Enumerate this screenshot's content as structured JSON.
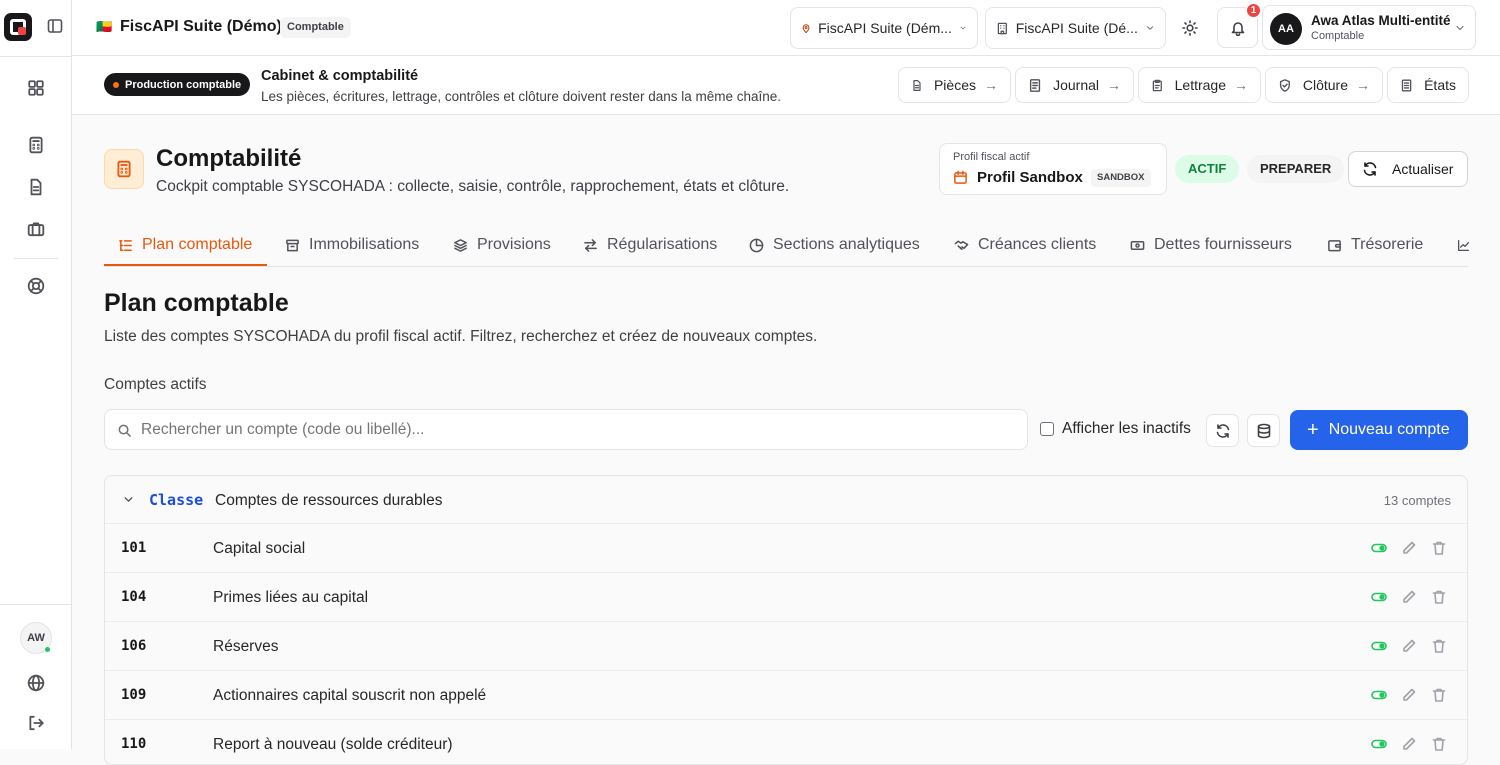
{
  "app": {
    "name": "FiscAPI Suite (Démo)",
    "role_badge": "Comptable",
    "flag": "🇧🇯"
  },
  "topbar": {
    "org_select": "FiscAPI Suite (Dém...",
    "entity_select": "FiscAPI Suite (Dé...",
    "notifications_count": "1",
    "user": {
      "initials": "AA",
      "name": "Awa Atlas Multi-entité",
      "role": "Comptable"
    }
  },
  "sidebar": {
    "items": [
      "dashboard",
      "calculator",
      "documents",
      "briefcase",
      "support"
    ],
    "user_initials": "AW"
  },
  "banner": {
    "badge": "Production comptable",
    "title": "Cabinet & comptabilité",
    "subtitle": "Les pièces, écritures, lettrage, contrôles et clôture doivent rester dans la même chaîne.",
    "links": [
      {
        "label": "Pièces",
        "icon": "document-icon"
      },
      {
        "label": "Journal",
        "icon": "journal-icon"
      },
      {
        "label": "Lettrage",
        "icon": "clipboard-icon"
      },
      {
        "label": "Clôture",
        "icon": "shield-icon"
      },
      {
        "label": "États",
        "icon": "report-icon"
      }
    ]
  },
  "page": {
    "title": "Comptabilité",
    "subtitle": "Cockpit comptable SYSCOHADA : collecte, saisie, contrôle, rapprochement, états et clôture.",
    "fiscal_profile": {
      "caption": "Profil fiscal actif",
      "name": "Profil Sandbox",
      "env": "SANDBOX"
    },
    "status_active": "ACTIF",
    "status_mode": "PREPARER",
    "refresh_label": "Actualiser"
  },
  "tabs": [
    {
      "label": "Plan comptable",
      "active": true
    },
    {
      "label": "Immobilisations"
    },
    {
      "label": "Provisions"
    },
    {
      "label": "Régularisations"
    },
    {
      "label": "Sections analytiques"
    },
    {
      "label": "Créances clients"
    },
    {
      "label": "Dettes fournisseurs"
    },
    {
      "label": "Trésorerie"
    }
  ],
  "section": {
    "title": "Plan comptable",
    "description": "Liste des comptes SYSCOHADA du profil fiscal actif. Filtrez, recherchez et créez de nouveaux comptes.",
    "subtitle": "Comptes actifs",
    "search_placeholder": "Rechercher un compte (code ou libellé)...",
    "show_inactive_label": "Afficher les inactifs",
    "new_account_label": "Nouveau compte"
  },
  "group": {
    "classe_label": "Classe",
    "name": "Comptes de ressources durables",
    "count": "13 comptes",
    "accounts": [
      {
        "code": "101",
        "label": "Capital social"
      },
      {
        "code": "104",
        "label": "Primes liées au capital"
      },
      {
        "code": "106",
        "label": "Réserves"
      },
      {
        "code": "109",
        "label": "Actionnaires capital souscrit non appelé"
      },
      {
        "code": "110",
        "label": "Report à nouveau (solde créditeur)"
      }
    ]
  },
  "colors": {
    "primary": "#2563eb",
    "accent_orange": "#ea580c",
    "active_green": "#16a34a"
  }
}
